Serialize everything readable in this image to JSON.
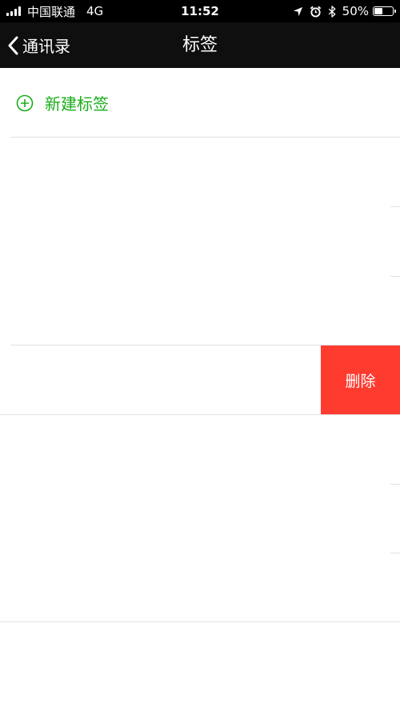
{
  "status_bar": {
    "carrier": "中国联通",
    "network": "4G",
    "time": "11:52",
    "battery_text": "50%",
    "battery_level": 0.5,
    "icons": [
      "signal-icon",
      "location-icon",
      "alarm-icon",
      "bluetooth-icon",
      "battery-icon"
    ]
  },
  "nav": {
    "back_label": "通讯录",
    "title": "标签"
  },
  "new_tag": {
    "label": "新建标签",
    "icon": "plus-circle-icon",
    "color": "#1aad19"
  },
  "swipe_action": {
    "delete_label": "删除",
    "color": "#ff3b30"
  },
  "colors": {
    "status_bar": "#000000",
    "nav_bar": "#0f0f0f",
    "divider": "#e2e2e2"
  }
}
